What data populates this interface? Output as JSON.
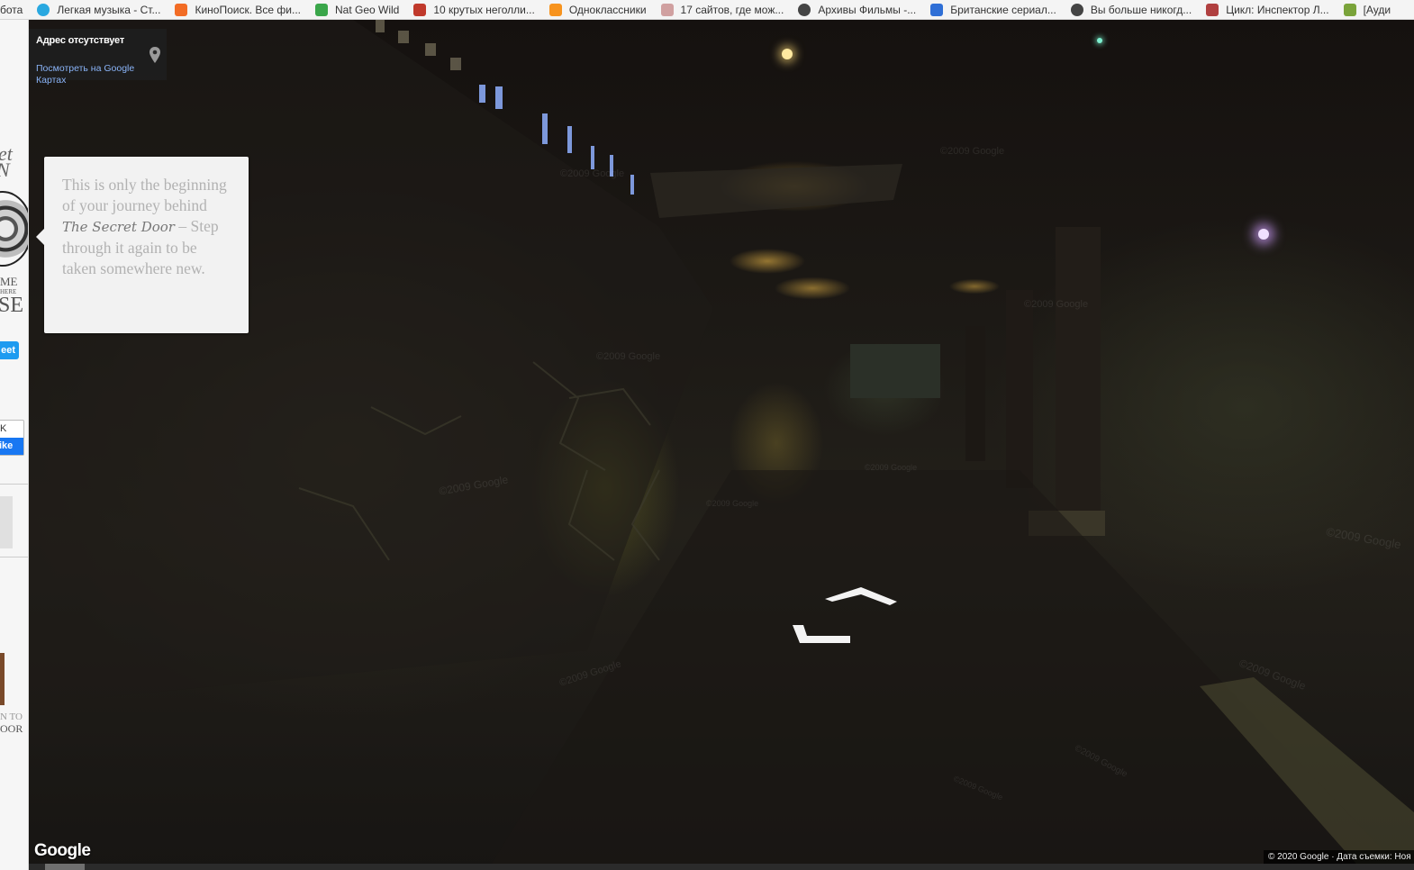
{
  "bookmarks": [
    {
      "label": "бота",
      "icon": "none",
      "color": "#f4f4f4"
    },
    {
      "label": "Легкая музыка - Ст...",
      "icon": "music-icon",
      "color": "#29a8e0"
    },
    {
      "label": "КиноПоиск. Все фи...",
      "icon": "kinopoisk-icon",
      "color": "#f26c25"
    },
    {
      "label": "Nat Geo Wild",
      "icon": "natgeo-icon",
      "color": "#3aa64a"
    },
    {
      "label": "10 крутых неголли...",
      "icon": "film-icon",
      "color": "#c0392b"
    },
    {
      "label": "Одноклассники",
      "icon": "ok-icon",
      "color": "#f7931e"
    },
    {
      "label": "17 сайтов, где мож...",
      "icon": "shield-icon",
      "color": "#d0a0a0"
    },
    {
      "label": "Архивы Фильмы -...",
      "icon": "globe-icon",
      "color": "#444444"
    },
    {
      "label": "Британские сериал...",
      "icon": "calendar-icon",
      "color": "#2f6fd6"
    },
    {
      "label": "Вы больше никогд...",
      "icon": "globe-icon",
      "color": "#444444"
    },
    {
      "label": "Цикл: Инспектор Л...",
      "icon": "book-icon",
      "color": "#b04040"
    },
    {
      "label": "[Ауди",
      "icon": "puzzle-icon",
      "color": "#7aa33a"
    }
  ],
  "left_strip": {
    "script_top": "et",
    "script_n": "N",
    "me": "ME",
    "here": "HERE",
    "se": "SE",
    "tweet": "eet",
    "fb_label": "K",
    "fb_like": "ike",
    "to": "N TO",
    "door": "OOR"
  },
  "address_card": {
    "title": "Адрес отсутствует",
    "link": "Посмотреть на Google Картах"
  },
  "tooltip": {
    "line1": "This is only the beginning of your journey behind",
    "script": "The Secret Door",
    "line2": "– Step through it again to be taken somewhere new."
  },
  "watermarks": [
    "©2009 Google",
    "©2009 Google",
    "©2009 Google",
    "©2009 Google",
    "©2009 Google",
    "©2009 Google",
    "©2009 Google",
    "©2009 Google",
    "©2009 Google",
    "©2009 Google",
    "©2009 Google",
    "©2009 Google"
  ],
  "google_logo": "Google",
  "footer": "© 2020 Google · Дата съемки: Ноя"
}
